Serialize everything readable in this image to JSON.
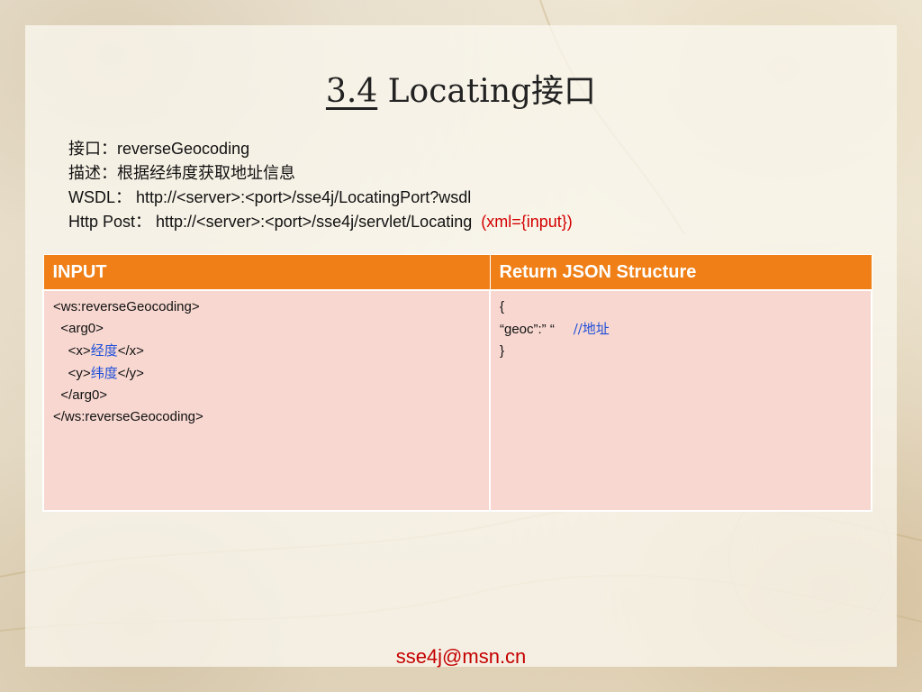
{
  "slide": {
    "title_num": "3.4",
    "title_text": " Locating接口"
  },
  "info": {
    "line1_cn": "接口：",
    "line1_val": "reverseGeocoding",
    "line2": "描述：根据经纬度获取地址信息",
    "line3": "WSDL：  http://<server>:<port>/sse4j/LocatingPort?wsdl",
    "line4": "Http Post：  http://<server>:<port>/sse4j/servlet/Locating",
    "line4_red": "(xml={input})"
  },
  "table": {
    "headers": [
      "INPUT",
      "Return JSON Structure"
    ],
    "input_lines": [
      "<ws:reverseGeocoding>",
      "<arg0>",
      "<x>",
      "经度",
      "</x>",
      "<y>",
      "纬度",
      "</y>",
      "</arg0>",
      "</ws:reverseGeocoding>"
    ],
    "output_lines": [
      "{",
      "“geoc”:” “",
      "//地址",
      "}"
    ]
  },
  "footer": {
    "email": "sse4j@msn.cn"
  },
  "colors": {
    "header_orange": "#ef7f16",
    "cell_pink": "#f7d7d0",
    "accent_red": "#d40000",
    "accent_blue": "#1f4fd8"
  }
}
